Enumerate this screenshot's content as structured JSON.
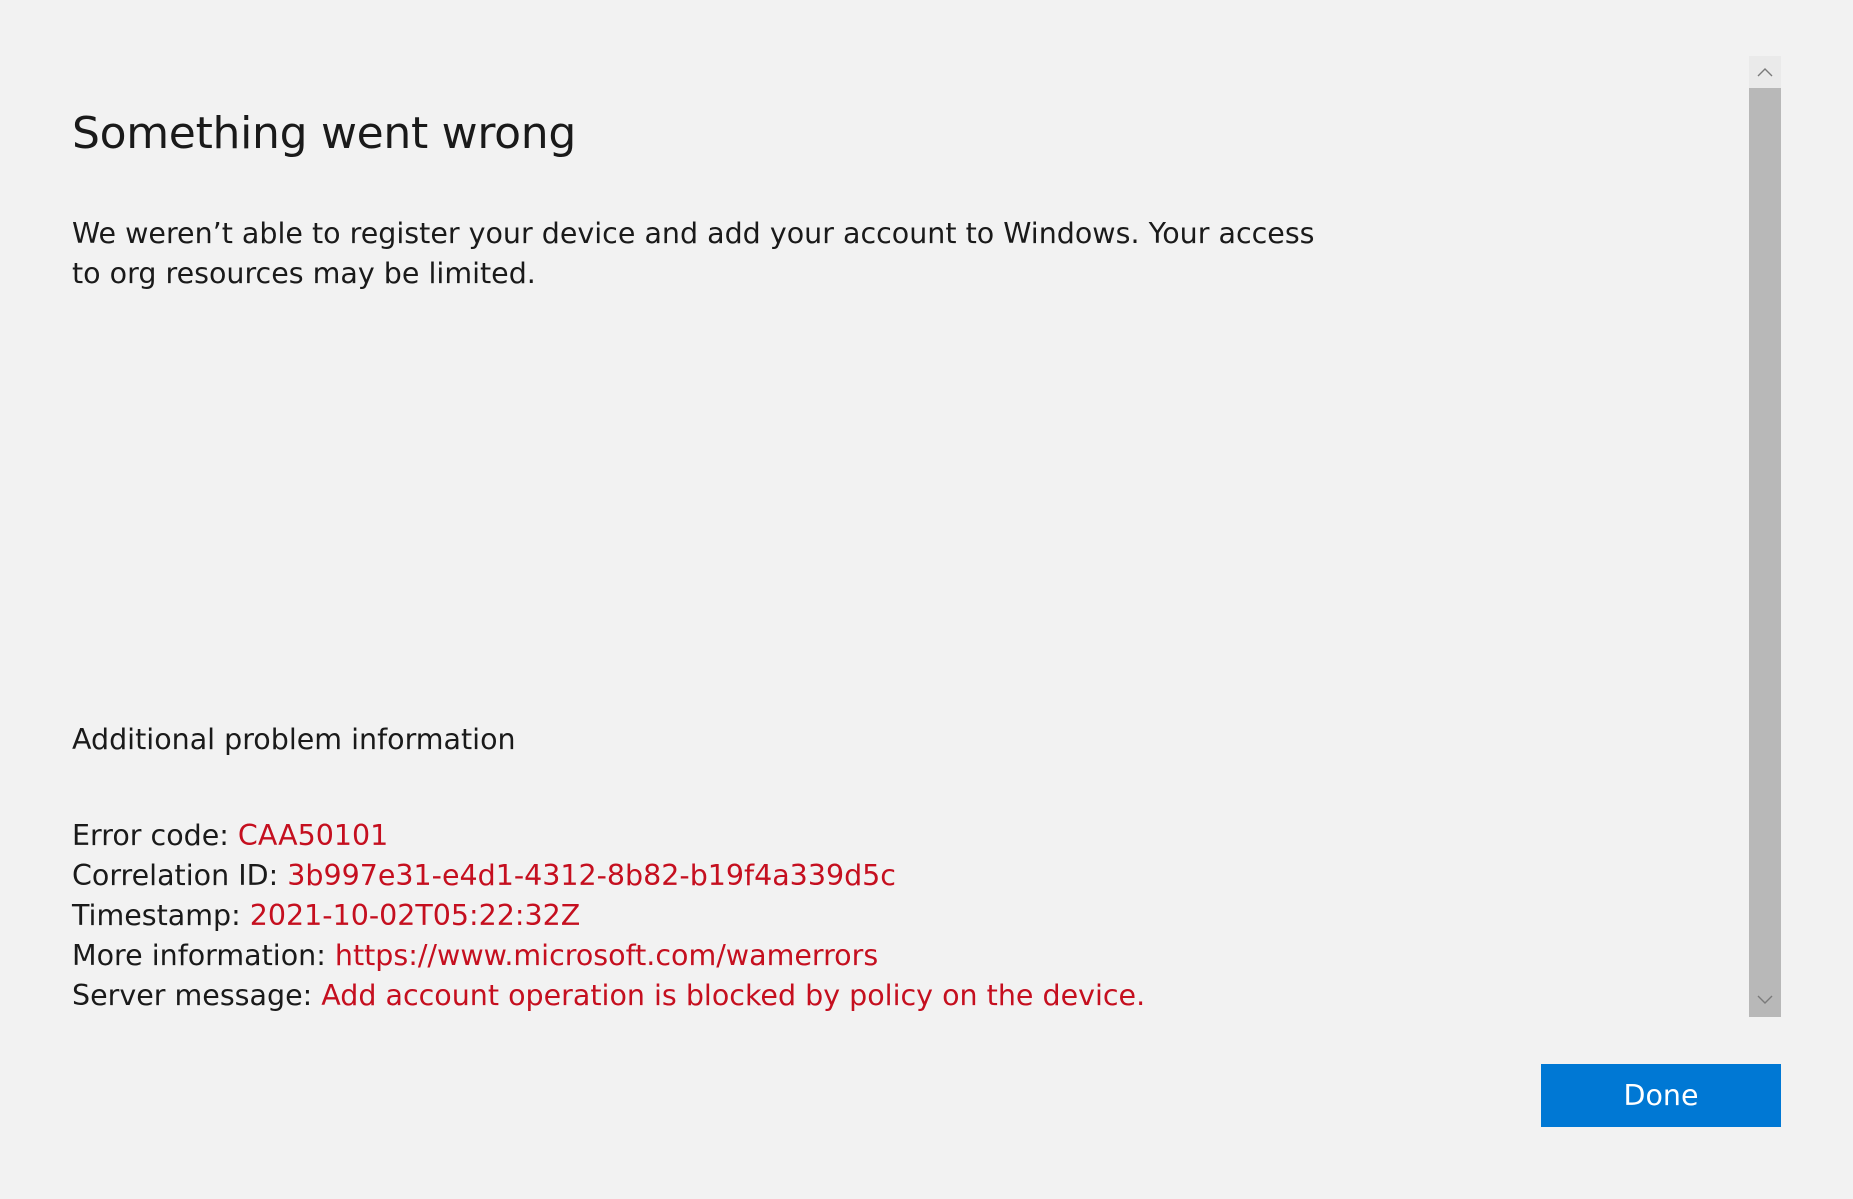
{
  "dialog": {
    "title": "Something went wrong",
    "description": "We weren’t able to register your device and add your account to Windows. Your access to org resources may be limited."
  },
  "additional_info": {
    "heading": "Additional problem information",
    "rows": [
      {
        "label": "Error code: ",
        "value": "CAA50101"
      },
      {
        "label": "Correlation ID: ",
        "value": "3b997e31-e4d1-4312-8b82-b19f4a339d5c"
      },
      {
        "label": "Timestamp: ",
        "value": "2021-10-02T05:22:32Z"
      },
      {
        "label": "More information: ",
        "value": "https://www.microsoft.com/wamerrors"
      },
      {
        "label": "Server message: ",
        "value": "Add account operation is blocked by policy on the device."
      }
    ]
  },
  "scrollbar": {
    "up_icon": "chevron-up-icon",
    "down_icon": "chevron-down-icon"
  },
  "footer": {
    "done_label": "Done"
  },
  "colors": {
    "background": "#f2f2f2",
    "error_text": "#c50f1f",
    "accent": "#0078d4",
    "scroll_thumb": "#b8b8b8"
  }
}
